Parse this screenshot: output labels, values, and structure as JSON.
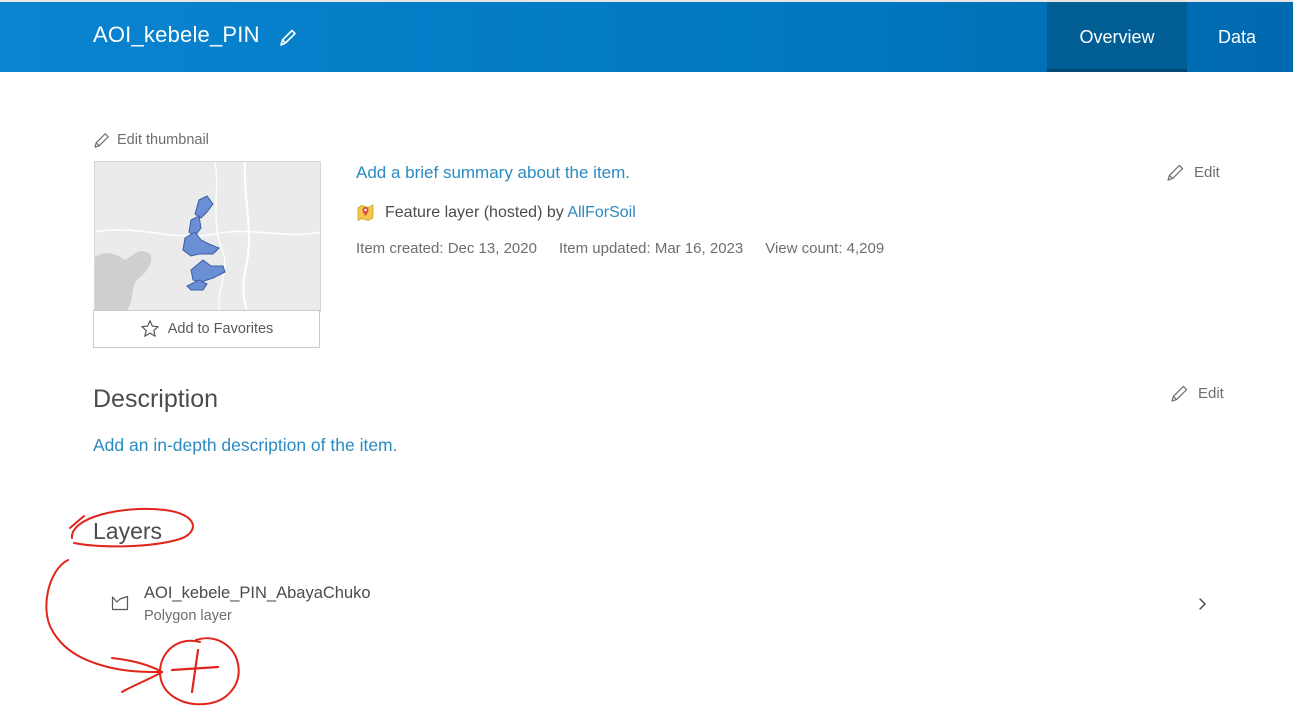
{
  "header": {
    "title": "AOI_kebele_PIN",
    "tabs": [
      {
        "label": "Overview",
        "active": true
      },
      {
        "label": "Data",
        "active": false
      }
    ]
  },
  "thumbnail": {
    "edit_label": "Edit thumbnail",
    "favorites_label": "Add to Favorites"
  },
  "summary": {
    "text": "Add a brief summary about the item.",
    "edit_label": "Edit"
  },
  "item_type": {
    "label": "Feature layer (hosted)",
    "by": "by",
    "owner": "AllForSoil"
  },
  "meta": {
    "created": "Item created: Dec 13, 2020",
    "updated": "Item updated: Mar 16, 2023",
    "views": "View count: 4,209"
  },
  "description": {
    "heading": "Description",
    "edit_label": "Edit",
    "placeholder": "Add an in-depth description of the item."
  },
  "layers": {
    "heading": "Layers",
    "items": [
      {
        "name": "AOI_kebele_PIN_AbayaChuko",
        "type": "Polygon layer"
      }
    ]
  },
  "colors": {
    "header_bg": "#0079c1",
    "active_tab": "#005e95",
    "link": "#2a8bc2",
    "annotation": "#e0251b"
  }
}
